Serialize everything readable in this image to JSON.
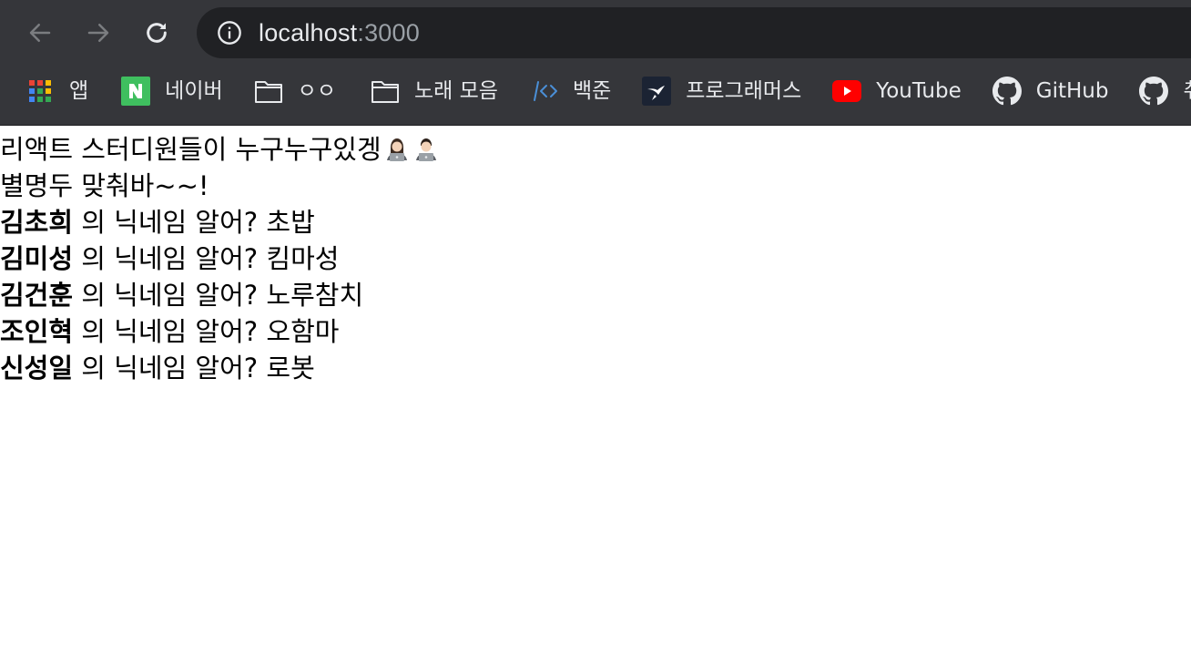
{
  "browser": {
    "url_host": "localhost",
    "url_port": ":3000",
    "bookmarks": [
      {
        "label": "앱",
        "icon": "apps-grid-icon"
      },
      {
        "label": "네이버",
        "icon": "naver-icon"
      },
      {
        "label": "ㅇㅇ",
        "icon": "folder-icon"
      },
      {
        "label": "노래 모음",
        "icon": "folder-icon"
      },
      {
        "label": "백준",
        "icon": "code-brackets-icon"
      },
      {
        "label": "프로그래머스",
        "icon": "programmers-icon"
      },
      {
        "label": "YouTube",
        "icon": "youtube-icon"
      },
      {
        "label": "GitHub",
        "icon": "github-icon"
      },
      {
        "label": "취업",
        "icon": "github-icon"
      }
    ]
  },
  "page": {
    "heading": "리액트 스터디원들이 누구누구있겡",
    "subheading": "별명두 맞춰바~~!",
    "suffix": " 의 닉네임 알어? ",
    "members": [
      {
        "name": "김초희",
        "nickname": "초밥"
      },
      {
        "name": "김미성",
        "nickname": "킴마성"
      },
      {
        "name": "김건훈",
        "nickname": "노루참치"
      },
      {
        "name": "조인혁",
        "nickname": "오함마"
      },
      {
        "name": "신성일",
        "nickname": "로봇"
      }
    ]
  },
  "colors": {
    "chrome_bg": "#35363a",
    "omnibox_bg": "#202124",
    "chrome_text": "#e8eaed",
    "muted_text": "#9aa0a6",
    "youtube_red": "#ff0000",
    "naver_green": "#03c75a"
  }
}
